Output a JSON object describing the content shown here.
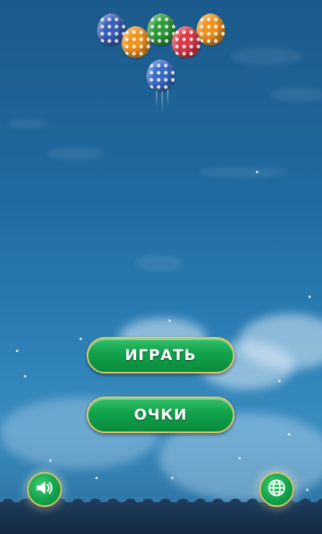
{
  "menu": {
    "play_label": "ИГРАТЬ",
    "scores_label": "ОЧКИ"
  },
  "controls": {
    "sound_icon": "speaker-icon",
    "language_icon": "globe-icon"
  },
  "eggs": [
    {
      "color": "#3a5fb8"
    },
    {
      "color": "#f0921e"
    },
    {
      "color": "#2f9a3a"
    },
    {
      "color": "#d93a4a"
    },
    {
      "color": "#f0921e"
    },
    {
      "color": "#3a6cc8"
    }
  ],
  "colors": {
    "button_green": "#12a24c",
    "button_border": "#d8c76a",
    "sky": "#1f6aa0"
  }
}
